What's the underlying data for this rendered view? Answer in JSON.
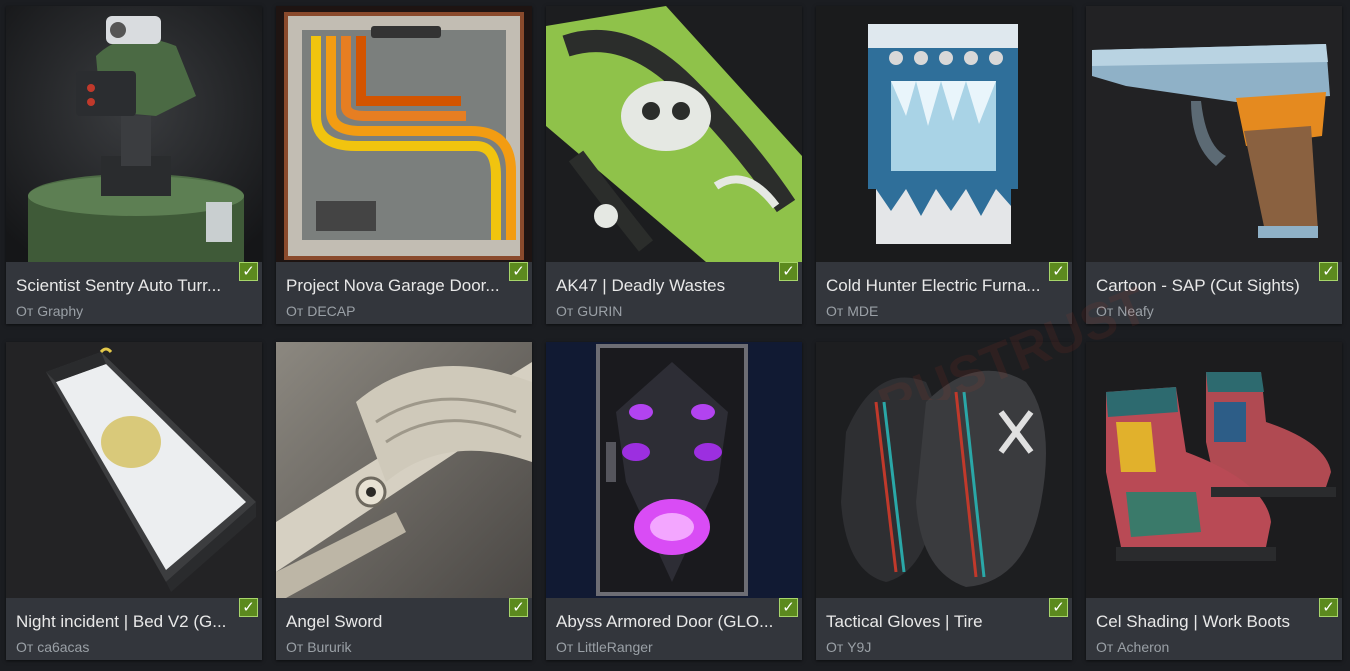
{
  "author_prefix": "От",
  "checkmark_glyph": "✓",
  "watermark_text": "RUSTRUST",
  "items": [
    {
      "title": "Scientist Sentry Auto Turr...",
      "author": "Graphy",
      "approved": true,
      "thumb_icon": "sentry-turret-image"
    },
    {
      "title": "Project Nova Garage Door...",
      "author": "DECAP",
      "approved": true,
      "thumb_icon": "garage-door-image"
    },
    {
      "title": "AK47 | Deadly Wastes",
      "author": "GURIN",
      "approved": true,
      "thumb_icon": "ak47-rifle-image"
    },
    {
      "title": "Cold Hunter Electric Furna...",
      "author": "MDE",
      "approved": true,
      "thumb_icon": "electric-furnace-image"
    },
    {
      "title": "Cartoon - SAP (Cut Sights)",
      "author": "Neafy",
      "approved": true,
      "thumb_icon": "pistol-image"
    },
    {
      "title": "Night incident | Bed V2 (G...",
      "author": "са6асаs",
      "approved": true,
      "thumb_icon": "bed-image"
    },
    {
      "title": "Angel Sword",
      "author": "Bururik",
      "approved": true,
      "thumb_icon": "sword-image"
    },
    {
      "title": "Abyss Armored Door (GLO...",
      "author": "LittleRanger",
      "approved": true,
      "thumb_icon": "armored-door-image"
    },
    {
      "title": "Tactical Gloves | Tire",
      "author": "Y9J",
      "approved": true,
      "thumb_icon": "gloves-image"
    },
    {
      "title": "Cel Shading | Work Boots",
      "author": "Acheron",
      "approved": true,
      "thumb_icon": "boots-image"
    }
  ]
}
